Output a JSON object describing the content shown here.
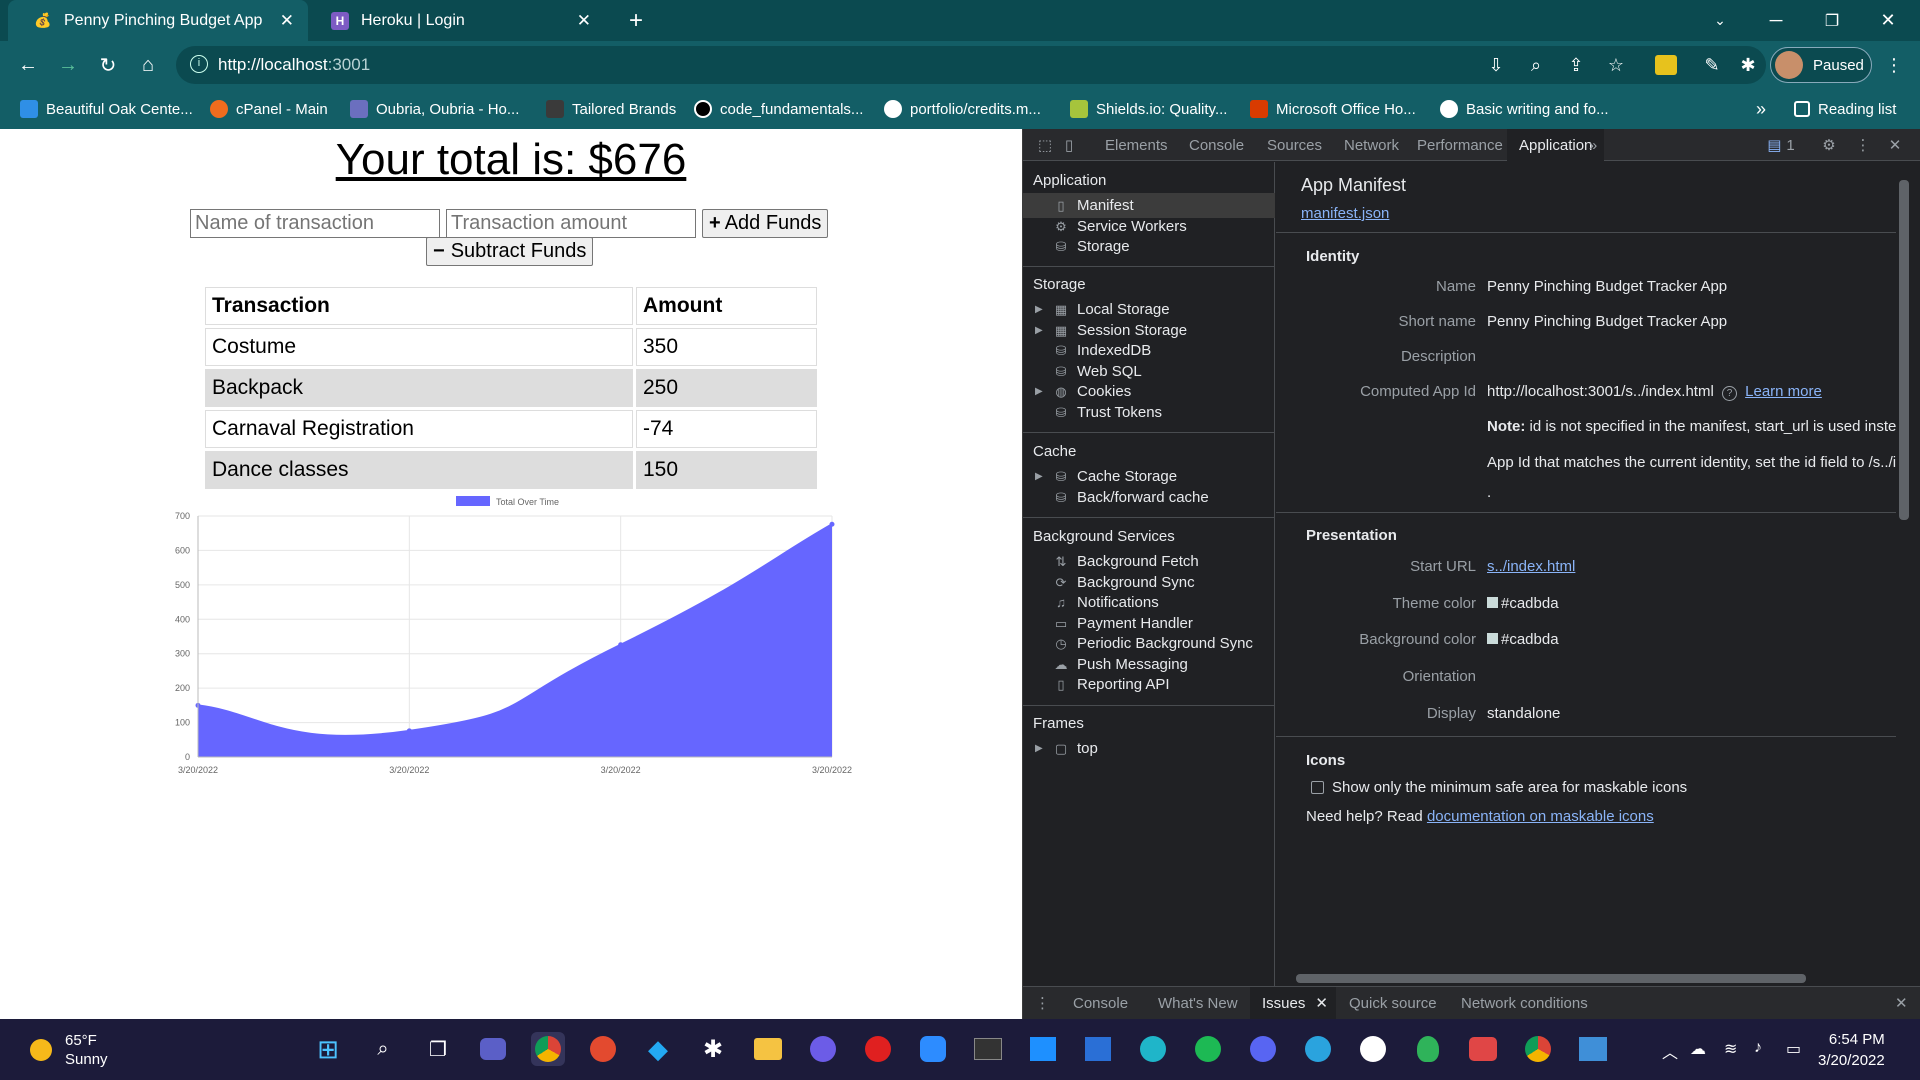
{
  "browser": {
    "tabs": [
      {
        "title": "Penny Pinching Budget App",
        "active": true
      },
      {
        "title": "Heroku | Login",
        "active": false
      }
    ],
    "url_host": "http://localhost",
    "url_port": ":3001",
    "profile_label": "Paused",
    "bookmarks": [
      "Beautiful Oak Cente...",
      "cPanel - Main",
      "Oubria, Oubria - Ho...",
      "Tailored Brands",
      "code_fundamentals...",
      "portfolio/credits.m...",
      "Shields.io: Quality...",
      "Microsoft Office Ho...",
      "Basic writing and fo..."
    ],
    "reading_list": "Reading list",
    "more_bookmarks": "»"
  },
  "app": {
    "total_text": "Your total is: $676",
    "name_placeholder": "Name of transaction",
    "amount_placeholder": "Transaction amount",
    "add_label": "Add Funds",
    "subtract_label": "Subtract Funds",
    "table": {
      "headers": [
        "Transaction",
        "Amount"
      ],
      "rows": [
        [
          "Costume",
          "350"
        ],
        [
          "Backpack",
          "250"
        ],
        [
          "Carnaval Registration",
          "-74"
        ],
        [
          "Dance classes",
          "150"
        ]
      ]
    }
  },
  "chart_data": {
    "type": "area",
    "title": "",
    "legend": "Total Over Time",
    "legend_position": "top",
    "x": [
      "3/20/2022",
      "3/20/2022",
      "3/20/2022",
      "3/20/2022"
    ],
    "series": [
      {
        "name": "Total Over Time",
        "values": [
          150,
          76,
          326,
          676
        ]
      }
    ],
    "ylim": [
      0,
      700
    ],
    "yticks": [
      0,
      100,
      200,
      300,
      400,
      500,
      600,
      700
    ],
    "fill_color": "#6666ff",
    "grid": true
  },
  "devtools": {
    "tabs": [
      "Elements",
      "Console",
      "Sources",
      "Network",
      "Performance",
      "Application"
    ],
    "active_tab": "Application",
    "issues_badge": "1",
    "sidebar": {
      "application_header": "Application",
      "application_items": [
        "Manifest",
        "Service Workers",
        "Storage"
      ],
      "storage_header": "Storage",
      "storage_items": [
        "Local Storage",
        "Session Storage",
        "IndexedDB",
        "Web SQL",
        "Cookies",
        "Trust Tokens"
      ],
      "cache_header": "Cache",
      "cache_items": [
        "Cache Storage",
        "Back/forward cache"
      ],
      "bg_header": "Background Services",
      "bg_items": [
        "Background Fetch",
        "Background Sync",
        "Notifications",
        "Payment Handler",
        "Periodic Background Sync",
        "Push Messaging",
        "Reporting API"
      ],
      "frames_header": "Frames",
      "frames_items": [
        "top"
      ]
    },
    "manifest": {
      "title": "App Manifest",
      "file_link": "manifest.json",
      "identity_header": "Identity",
      "name_label": "Name",
      "name_value": "Penny Pinching Budget Tracker App",
      "short_name_label": "Short name",
      "short_name_value": "Penny Pinching Budget Tracker App",
      "description_label": "Description",
      "computed_id_label": "Computed App Id",
      "computed_id_value": "http://localhost:3001/s../index.html",
      "learn_more": "Learn more",
      "note_bold": "Note:",
      "note_text": "id is not specified in the manifest, start_url is used instea",
      "note_text2": "App Id that matches the current identity, set the id field to /s../i",
      "note_text3": ".",
      "presentation_header": "Presentation",
      "start_url_label": "Start URL",
      "start_url_value": "s../index.html",
      "theme_color_label": "Theme color",
      "theme_color_value": "#cadbda",
      "bg_color_label": "Background color",
      "bg_color_value": "#cadbda",
      "orientation_label": "Orientation",
      "display_label": "Display",
      "display_value": "standalone",
      "icons_header": "Icons",
      "maskable_label": "Show only the minimum safe area for maskable icons",
      "help_text": "Need help? Read ",
      "help_link": "documentation on maskable icons"
    },
    "drawer_tabs": [
      "Console",
      "What's New",
      "Issues",
      "Quick source",
      "Network conditions"
    ],
    "drawer_active": "Issues"
  },
  "taskbar": {
    "temp": "65°F",
    "condition": "Sunny",
    "time": "6:54 PM",
    "date": "3/20/2022"
  }
}
